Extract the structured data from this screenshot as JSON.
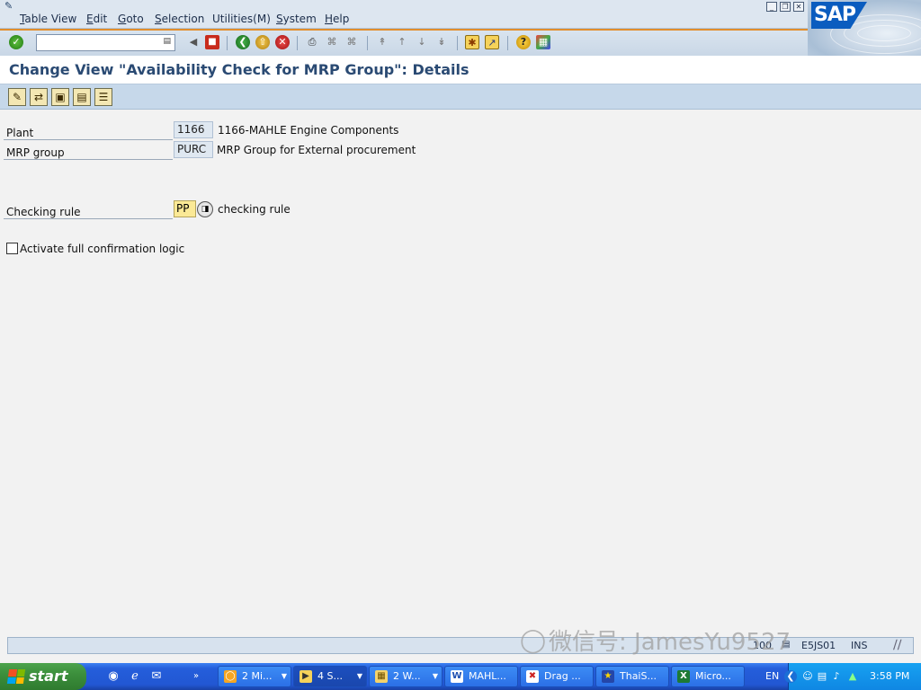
{
  "menu": {
    "items": [
      "Table View",
      "Edit",
      "Goto",
      "Selection",
      "Utilities(M)",
      "System",
      "Help"
    ],
    "underline_first": [
      true,
      true,
      true,
      true,
      false,
      true,
      true
    ]
  },
  "toolbar": {
    "command_field_value": "",
    "icons": [
      "enter-icon",
      "back-arrow-icon",
      "save-icon",
      "back-icon",
      "exit-icon",
      "cancel-icon",
      "print-icon",
      "find-icon",
      "find-next-icon",
      "first-page-icon",
      "previous-page-icon",
      "next-page-icon",
      "last-page-icon",
      "create-session-icon",
      "shortcut-icon",
      "help-icon",
      "customize-layout-icon"
    ]
  },
  "logo": {
    "text": "SAP"
  },
  "title": "Change View \"Availability Check for MRP Group\": Details",
  "app_toolbar": {
    "buttons": [
      "display-change-icon",
      "other-entry-icon",
      "previous-entry-icon",
      "next-entry-icon",
      "variable-list-icon"
    ]
  },
  "form": {
    "plant": {
      "label": "Plant",
      "value": "1166",
      "description": "1166-MAHLE Engine Components"
    },
    "mrp_group": {
      "label": "MRP group",
      "value": "PURC",
      "description": "MRP Group for External procurement"
    },
    "checking_rule": {
      "label": "Checking rule",
      "value": "PP",
      "description": "checking rule"
    },
    "full_confirmation": {
      "label": "Activate full confirmation logic",
      "checked": false
    }
  },
  "status_bar": {
    "client": "100",
    "server": "E5JS01",
    "mode": "INS"
  },
  "watermark": {
    "text": "微信号: JamesYu9527"
  },
  "taskbar": {
    "start_label": "start",
    "tasks": [
      {
        "label": "2 Mi...",
        "icon": "outlook-icon",
        "has_group": true,
        "active": false
      },
      {
        "label": "4 S...",
        "icon": "sap-icon",
        "has_group": true,
        "active": true
      },
      {
        "label": "2 W...",
        "icon": "folder-icon",
        "has_group": true,
        "active": false
      },
      {
        "label": "MAHL...",
        "icon": "word-icon",
        "has_group": false,
        "active": false
      },
      {
        "label": "Drag ...",
        "icon": "drag-icon",
        "has_group": false,
        "active": false
      },
      {
        "label": "ThaiS...",
        "icon": "thai-icon",
        "has_group": false,
        "active": false
      },
      {
        "label": "Micro...",
        "icon": "excel-icon",
        "has_group": false,
        "active": false
      }
    ],
    "language": "EN",
    "clock": "3:58 PM"
  }
}
